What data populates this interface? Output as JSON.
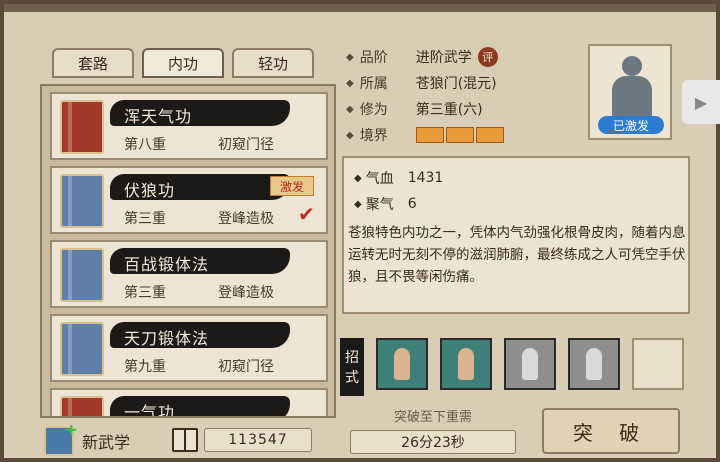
{
  "tabs": [
    {
      "label": "套路"
    },
    {
      "label": "内功"
    },
    {
      "label": "轻功"
    }
  ],
  "skills": [
    {
      "name": "浑天气功",
      "level": "第八重",
      "stage": "初窥门径",
      "book_color": "red"
    },
    {
      "name": "伏狼功",
      "level": "第三重",
      "stage": "登峰造极",
      "book_color": "blue",
      "badge": "激发",
      "selected": true
    },
    {
      "name": "百战锻体法",
      "level": "第三重",
      "stage": "登峰造极",
      "book_color": "blue"
    },
    {
      "name": "天刀锻体法",
      "level": "第九重",
      "stage": "初窥门径",
      "book_color": "blue"
    },
    {
      "name": "一气功",
      "level": "",
      "stage": "",
      "book_color": "red"
    }
  ],
  "details": {
    "rank_label": "品阶",
    "rank_value": "进阶武学",
    "rank_tag": "评",
    "sect_label": "所属",
    "sect_value": "苍狼门(混元)",
    "cultivation_label": "修为",
    "cultivation_value": "第三重(六)",
    "realm_label": "境界",
    "realm_segments": 3
  },
  "portrait": {
    "status": "已激发"
  },
  "stats": {
    "hp_label": "气血",
    "hp_value": "1431",
    "qi_label": "聚气",
    "qi_value": "6"
  },
  "description": "苍狼特色内功之一，凭体内气劲强化根骨皮肉，随着内息运转无时无刻不停的滋润肺腑，最终练成之人可凭空手伏狼，且不畏等闲伤痛。",
  "moves": {
    "label_top": "招",
    "label_bottom": "式"
  },
  "breakthrough": {
    "label": "突破至下重需",
    "timer": "26分23秒",
    "button": "突 破"
  },
  "footer": {
    "new_skill": "新武学",
    "resource_count": "113547"
  },
  "colors": {
    "accent_orange": "#e89a38",
    "status_blue": "#2c7cd1",
    "badge_red": "#b3261e"
  }
}
